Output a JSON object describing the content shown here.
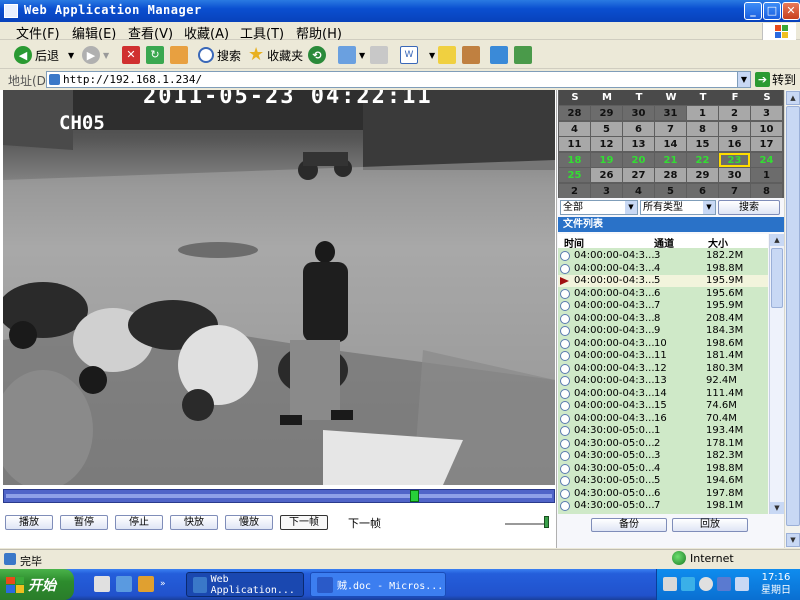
{
  "window": {
    "title": "Web Application Manager",
    "min": "_",
    "max": "□",
    "close": "✕"
  },
  "menu": [
    "文件(F)",
    "编辑(E)",
    "查看(V)",
    "收藏(A)",
    "工具(T)",
    "帮助(H)"
  ],
  "toolbar": {
    "back": "后退",
    "search": "搜索",
    "favorites": "收藏夹"
  },
  "address": {
    "label": "地址(D)",
    "url": "http://192.168.1.234/",
    "go": "转到"
  },
  "video": {
    "timestamp": "2011-05-23 04:22:11",
    "channel": "CH05",
    "playback_position": 0.75
  },
  "controls": {
    "buttons": [
      "播放",
      "暂停",
      "停止",
      "快放",
      "慢放",
      "下一帧"
    ],
    "next_label": "下一帧",
    "volume": 1.0
  },
  "calendar": {
    "weekdays": [
      "S",
      "M",
      "T",
      "W",
      "T",
      "F",
      "S"
    ],
    "weeks": [
      [
        {
          "d": "28",
          "s": "out"
        },
        {
          "d": "29",
          "s": "out"
        },
        {
          "d": "30",
          "s": "out"
        },
        {
          "d": "31",
          "s": "out"
        },
        {
          "d": "1",
          "s": "in"
        },
        {
          "d": "2",
          "s": "in"
        },
        {
          "d": "3",
          "s": "in"
        }
      ],
      [
        {
          "d": "4",
          "s": "in"
        },
        {
          "d": "5",
          "s": "in"
        },
        {
          "d": "6",
          "s": "in"
        },
        {
          "d": "7",
          "s": "in"
        },
        {
          "d": "8",
          "s": "in"
        },
        {
          "d": "9",
          "s": "in"
        },
        {
          "d": "10",
          "s": "in"
        }
      ],
      [
        {
          "d": "11",
          "s": "in"
        },
        {
          "d": "12",
          "s": "in"
        },
        {
          "d": "13",
          "s": "in"
        },
        {
          "d": "14",
          "s": "in"
        },
        {
          "d": "15",
          "s": "in"
        },
        {
          "d": "16",
          "s": "in"
        },
        {
          "d": "17",
          "s": "in"
        }
      ],
      [
        {
          "d": "18",
          "s": "green"
        },
        {
          "d": "19",
          "s": "green"
        },
        {
          "d": "20",
          "s": "green"
        },
        {
          "d": "21",
          "s": "green"
        },
        {
          "d": "22",
          "s": "green"
        },
        {
          "d": "23",
          "s": "selected"
        },
        {
          "d": "24",
          "s": "green"
        }
      ],
      [
        {
          "d": "25",
          "s": "green"
        },
        {
          "d": "26",
          "s": "in"
        },
        {
          "d": "27",
          "s": "in"
        },
        {
          "d": "28",
          "s": "in"
        },
        {
          "d": "29",
          "s": "in"
        },
        {
          "d": "30",
          "s": "in"
        },
        {
          "d": "1",
          "s": "out"
        }
      ],
      [
        {
          "d": "2",
          "s": "out"
        },
        {
          "d": "3",
          "s": "out"
        },
        {
          "d": "4",
          "s": "out"
        },
        {
          "d": "5",
          "s": "out"
        },
        {
          "d": "6",
          "s": "out"
        },
        {
          "d": "7",
          "s": "out"
        },
        {
          "d": "8",
          "s": "out"
        }
      ]
    ]
  },
  "filter": {
    "scope": "全部",
    "type": "所有类型",
    "search": "搜索"
  },
  "file_list": {
    "title": "文件列表",
    "headers": [
      "时间",
      "通道",
      "大小"
    ],
    "active_index": 2,
    "rows": [
      [
        "04:00:00-04:3...",
        "3",
        "182.2M"
      ],
      [
        "04:00:00-04:3...",
        "4",
        "198.8M"
      ],
      [
        "04:00:00-04:3...",
        "5",
        "195.9M"
      ],
      [
        "04:00:00-04:3...",
        "6",
        "195.6M"
      ],
      [
        "04:00:00-04:3...",
        "7",
        "195.9M"
      ],
      [
        "04:00:00-04:3...",
        "8",
        "208.4M"
      ],
      [
        "04:00:00-04:3...",
        "9",
        "184.3M"
      ],
      [
        "04:00:00-04:3...",
        "10",
        "198.6M"
      ],
      [
        "04:00:00-04:3...",
        "11",
        "181.4M"
      ],
      [
        "04:00:00-04:3...",
        "12",
        "180.3M"
      ],
      [
        "04:00:00-04:3...",
        "13",
        "92.4M"
      ],
      [
        "04:00:00-04:3...",
        "14",
        "111.4M"
      ],
      [
        "04:00:00-04:3...",
        "15",
        "74.6M"
      ],
      [
        "04:00:00-04:3...",
        "16",
        "70.4M"
      ],
      [
        "04:30:00-05:0...",
        "1",
        "193.4M"
      ],
      [
        "04:30:00-05:0...",
        "2",
        "178.1M"
      ],
      [
        "04:30:00-05:0...",
        "3",
        "182.3M"
      ],
      [
        "04:30:00-05:0...",
        "4",
        "198.8M"
      ],
      [
        "04:30:00-05:0...",
        "5",
        "194.6M"
      ],
      [
        "04:30:00-05:0...",
        "6",
        "197.8M"
      ],
      [
        "04:30:00-05:0...",
        "7",
        "198.1M"
      ]
    ]
  },
  "side_buttons": {
    "backup": "备份",
    "replay": "回放"
  },
  "status": {
    "text": "完毕",
    "zone": "Internet"
  },
  "taskbar": {
    "start": "开始",
    "tasks": [
      "Web Application...",
      "贼.doc - Micros..."
    ],
    "clock_time": "17:16",
    "clock_day": "星期日"
  }
}
